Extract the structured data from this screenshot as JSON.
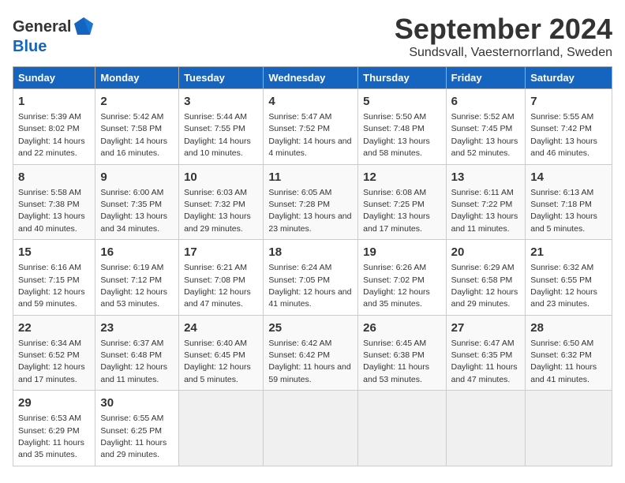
{
  "header": {
    "logo_general": "General",
    "logo_blue": "Blue",
    "title": "September 2024",
    "subtitle": "Sundsvall, Vaesternorrland, Sweden"
  },
  "days_of_week": [
    "Sunday",
    "Monday",
    "Tuesday",
    "Wednesday",
    "Thursday",
    "Friday",
    "Saturday"
  ],
  "weeks": [
    [
      {
        "day": "1",
        "sunrise": "5:39 AM",
        "sunset": "8:02 PM",
        "daylight": "14 hours and 22 minutes."
      },
      {
        "day": "2",
        "sunrise": "5:42 AM",
        "sunset": "7:58 PM",
        "daylight": "14 hours and 16 minutes."
      },
      {
        "day": "3",
        "sunrise": "5:44 AM",
        "sunset": "7:55 PM",
        "daylight": "14 hours and 10 minutes."
      },
      {
        "day": "4",
        "sunrise": "5:47 AM",
        "sunset": "7:52 PM",
        "daylight": "14 hours and 4 minutes."
      },
      {
        "day": "5",
        "sunrise": "5:50 AM",
        "sunset": "7:48 PM",
        "daylight": "13 hours and 58 minutes."
      },
      {
        "day": "6",
        "sunrise": "5:52 AM",
        "sunset": "7:45 PM",
        "daylight": "13 hours and 52 minutes."
      },
      {
        "day": "7",
        "sunrise": "5:55 AM",
        "sunset": "7:42 PM",
        "daylight": "13 hours and 46 minutes."
      }
    ],
    [
      {
        "day": "8",
        "sunrise": "5:58 AM",
        "sunset": "7:38 PM",
        "daylight": "13 hours and 40 minutes."
      },
      {
        "day": "9",
        "sunrise": "6:00 AM",
        "sunset": "7:35 PM",
        "daylight": "13 hours and 34 minutes."
      },
      {
        "day": "10",
        "sunrise": "6:03 AM",
        "sunset": "7:32 PM",
        "daylight": "13 hours and 29 minutes."
      },
      {
        "day": "11",
        "sunrise": "6:05 AM",
        "sunset": "7:28 PM",
        "daylight": "13 hours and 23 minutes."
      },
      {
        "day": "12",
        "sunrise": "6:08 AM",
        "sunset": "7:25 PM",
        "daylight": "13 hours and 17 minutes."
      },
      {
        "day": "13",
        "sunrise": "6:11 AM",
        "sunset": "7:22 PM",
        "daylight": "13 hours and 11 minutes."
      },
      {
        "day": "14",
        "sunrise": "6:13 AM",
        "sunset": "7:18 PM",
        "daylight": "13 hours and 5 minutes."
      }
    ],
    [
      {
        "day": "15",
        "sunrise": "6:16 AM",
        "sunset": "7:15 PM",
        "daylight": "12 hours and 59 minutes."
      },
      {
        "day": "16",
        "sunrise": "6:19 AM",
        "sunset": "7:12 PM",
        "daylight": "12 hours and 53 minutes."
      },
      {
        "day": "17",
        "sunrise": "6:21 AM",
        "sunset": "7:08 PM",
        "daylight": "12 hours and 47 minutes."
      },
      {
        "day": "18",
        "sunrise": "6:24 AM",
        "sunset": "7:05 PM",
        "daylight": "12 hours and 41 minutes."
      },
      {
        "day": "19",
        "sunrise": "6:26 AM",
        "sunset": "7:02 PM",
        "daylight": "12 hours and 35 minutes."
      },
      {
        "day": "20",
        "sunrise": "6:29 AM",
        "sunset": "6:58 PM",
        "daylight": "12 hours and 29 minutes."
      },
      {
        "day": "21",
        "sunrise": "6:32 AM",
        "sunset": "6:55 PM",
        "daylight": "12 hours and 23 minutes."
      }
    ],
    [
      {
        "day": "22",
        "sunrise": "6:34 AM",
        "sunset": "6:52 PM",
        "daylight": "12 hours and 17 minutes."
      },
      {
        "day": "23",
        "sunrise": "6:37 AM",
        "sunset": "6:48 PM",
        "daylight": "12 hours and 11 minutes."
      },
      {
        "day": "24",
        "sunrise": "6:40 AM",
        "sunset": "6:45 PM",
        "daylight": "12 hours and 5 minutes."
      },
      {
        "day": "25",
        "sunrise": "6:42 AM",
        "sunset": "6:42 PM",
        "daylight": "11 hours and 59 minutes."
      },
      {
        "day": "26",
        "sunrise": "6:45 AM",
        "sunset": "6:38 PM",
        "daylight": "11 hours and 53 minutes."
      },
      {
        "day": "27",
        "sunrise": "6:47 AM",
        "sunset": "6:35 PM",
        "daylight": "11 hours and 47 minutes."
      },
      {
        "day": "28",
        "sunrise": "6:50 AM",
        "sunset": "6:32 PM",
        "daylight": "11 hours and 41 minutes."
      }
    ],
    [
      {
        "day": "29",
        "sunrise": "6:53 AM",
        "sunset": "6:29 PM",
        "daylight": "11 hours and 35 minutes."
      },
      {
        "day": "30",
        "sunrise": "6:55 AM",
        "sunset": "6:25 PM",
        "daylight": "11 hours and 29 minutes."
      },
      null,
      null,
      null,
      null,
      null
    ]
  ],
  "labels": {
    "sunrise": "Sunrise:",
    "sunset": "Sunset:",
    "daylight": "Daylight:"
  }
}
